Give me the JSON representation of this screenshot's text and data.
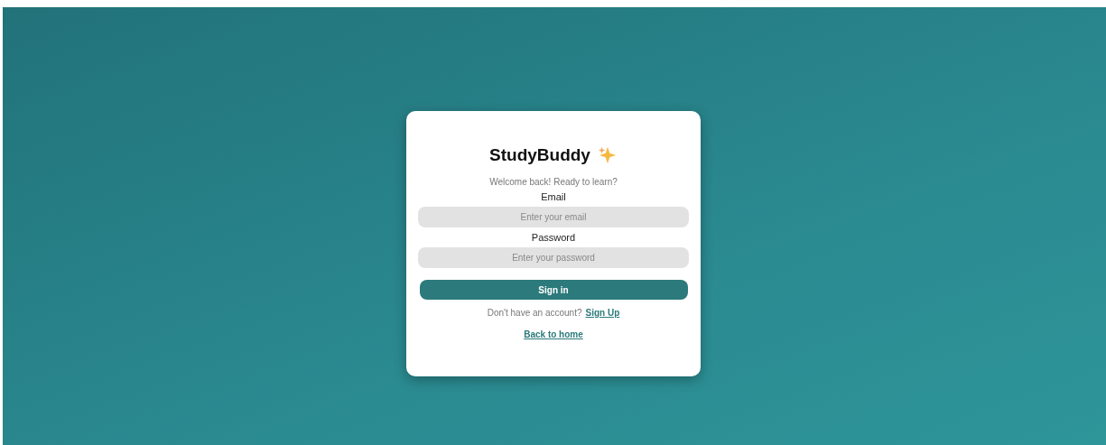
{
  "card": {
    "title": "StudyBuddy",
    "subtitle": "Welcome back! Ready to learn?",
    "fields": [
      {
        "label": "Email",
        "placeholder": "Enter your email"
      },
      {
        "label": "Password",
        "placeholder": "Enter your password"
      }
    ],
    "submit": "Sign in",
    "signup_prompt": "Don't have an account?",
    "signup_link": "Sign Up",
    "back_link": "Back to home"
  }
}
